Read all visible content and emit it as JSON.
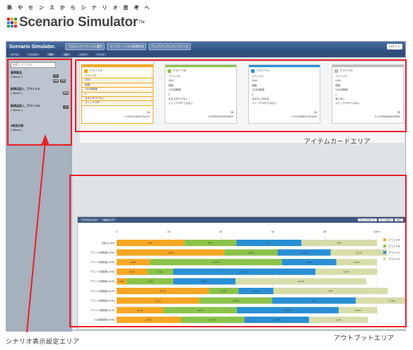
{
  "header": {
    "tagline": "熟 や セ ン ス か ら シ ナ リ オ 思 考 へ",
    "logo_text": "Scenario Simulator",
    "logo_tm": "TM",
    "logo_colors": [
      "#e8202a",
      "#f5a623",
      "#3c9a3c",
      "#2a8fd4",
      "#6b2d8f",
      "#f5a623",
      "#3c9a3c",
      "#2a8fd4",
      "#e8202a"
    ]
  },
  "window": {
    "title": "Scenario Simulator.",
    "title_buttons": [
      "プロジェクトファイル選択",
      "テンプレートから新規作成",
      "バックアップとメンテナンス"
    ],
    "tools": [
      "ホーム",
      "ファイル",
      "保存",
      "設定",
      "ヘルプ",
      "ツール"
    ],
    "right_button": "ログイン"
  },
  "sidebar": {
    "search_placeholder": "検索シナリオ名",
    "scenarios": [
      {
        "name": "基準製品",
        "sub": "( 0items )"
      },
      {
        "name": "新商品投入_ブランドA",
        "sub": "( 0items )"
      },
      {
        "name": "新商品投入_ブランドB",
        "sub": "( 0items )"
      },
      {
        "name": "3商品比較",
        "sub": "( 0items )"
      }
    ],
    "side_buttons": [
      "ブランド",
      "予算",
      "新規",
      "削除",
      "コピー"
    ]
  },
  "cards": [
    {
      "name": "ブランドA",
      "color": "#f5a623",
      "fields": [
        "ブランドA",
        "2000",
        "価格",
        "1日1回程度",
        "3",
        "あまり好きでない",
        "スイッチOFF"
      ],
      "num": "25",
      "result": "0.43521435682754379",
      "editable": true
    },
    {
      "name": "ブランドB",
      "color": "#8bc34a",
      "fields": [
        "ブランドB",
        "1800",
        "価格",
        "1日1回程度",
        "3",
        "あまり好きでない",
        "スイッチOFFではない"
      ],
      "num": "25",
      "result": "0.49980469225284820",
      "editable": false
    },
    {
      "name": "ブランドC",
      "color": "#2a8fd4",
      "fields": [
        "ブランドC",
        "1000",
        "価格",
        "1日1回程度",
        "3",
        "冷淡なし好める",
        "スイッチOFFではない"
      ],
      "num": "25",
      "result": "0.32418885931481603",
      "editable": false
    },
    {
      "name": "ブランドD",
      "color": "#bbb",
      "fields": [
        "ブランドD",
        "1400",
        "価格",
        "1日1回程度",
        "2",
        "常に好く",
        "スイッチOFFではない"
      ],
      "num": "25",
      "result": "-0.14108858536043984",
      "editable": false
    }
  ],
  "output": {
    "tabs": [
      "アイテムシェア",
      "全体シェア"
    ],
    "right_buttons": [
      "クリップボード",
      "データ出力",
      "表示"
    ]
  },
  "chart_data": {
    "type": "bar",
    "stacked": true,
    "orientation": "horizontal",
    "xlim": [
      0,
      100
    ],
    "x_ticks": [
      "0",
      "20",
      "40",
      "60",
      "80",
      "100%"
    ],
    "categories": [
      "全体 (n=200)",
      "ブランドA使用者 (n=60)",
      "ブランドB使用者 (n=50)",
      "ブランドC使用者 (n=50)",
      "ブランドD使用者 (n=40)",
      "ブランドA使用者 (n=40)",
      "ブランドB使用者 (n=40)",
      "ブランドC使用者 (n=40)",
      "その他使用者 (n=40)"
    ],
    "series": [
      {
        "name": "ブランドA",
        "color": "#f5a623",
        "values": [
          26,
          41.4,
          12.8,
          11.8,
          3.8,
          35.3,
          31.7,
          18.1,
          24.7
        ]
      },
      {
        "name": "ブランドB",
        "color": "#8bc34a",
        "values": [
          20,
          20.4,
          50.7,
          9.9,
          17.9,
          11.5,
          28.1,
          28.1,
          24.4
        ]
      },
      {
        "name": "ブランドC",
        "color": "#2a8fd4",
        "values": [
          25,
          20.4,
          20.9,
          54.7,
          24.0,
          13.4,
          32.1,
          39.1,
          24.8
        ]
      },
      {
        "name": "ブランドD",
        "color": "#d8dcaa",
        "values": [
          29,
          21.7,
          15.6,
          23.6,
          50.2,
          44,
          27.9,
          14.8,
          22.7
        ]
      }
    ],
    "data_labels": [
      [
        "26%",
        "20%",
        "25%",
        "29%"
      ],
      [
        "41.4%",
        "20.4%",
        "18.2%",
        "21.7%"
      ],
      [
        "12.8%",
        "50.7%",
        "20.9%",
        "15.6%"
      ],
      [
        "11.8%",
        "9.9%",
        "54.7%",
        "23.6%"
      ],
      [
        "3.8%",
        "17.9%",
        "24.0%",
        "50.2%"
      ],
      [
        "35.3%",
        "11.5%",
        "13.4%",
        "44%"
      ],
      [
        "31.7%",
        "28.1%",
        "32.1%",
        "27.9%"
      ],
      [
        "18.1%",
        "28.1%",
        "39.1%",
        "14.8%"
      ],
      [
        "24.7%",
        "24.4%",
        "24.8%",
        "22.7%"
      ]
    ]
  },
  "annotations": {
    "card_area": "アイテムカードエリア",
    "output_area": "アウトプットエリア",
    "scenario_area": "シナリオ表示設定エリア"
  }
}
